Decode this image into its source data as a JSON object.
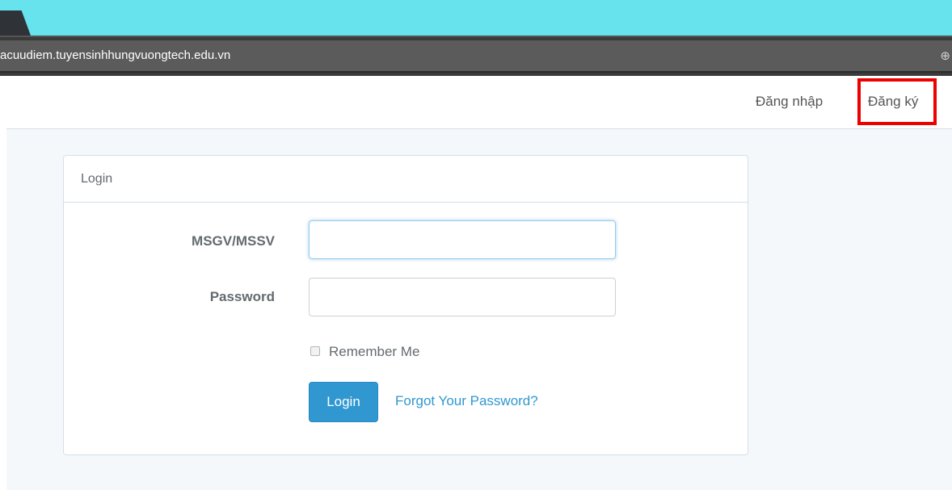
{
  "browser": {
    "url": "acuudiem.tuyensinhhungvuongtech.edu.vn",
    "zoom_icon": "zoom-icon"
  },
  "navbar": {
    "login_link": "Đăng nhập",
    "register_link": "Đăng ký",
    "highlight_color": "#ee0000"
  },
  "panel": {
    "title": "Login",
    "msgv_label": "MSGV/MSSV",
    "msgv_value": "",
    "password_label": "Password",
    "password_value": "",
    "remember_label": "Remember Me",
    "remember_checked": false,
    "login_button": "Login",
    "forgot_link": "Forgot Your Password?"
  },
  "colors": {
    "browser_bar": "#66e3ed",
    "primary": "#3097d1",
    "text": "#636b6f"
  }
}
